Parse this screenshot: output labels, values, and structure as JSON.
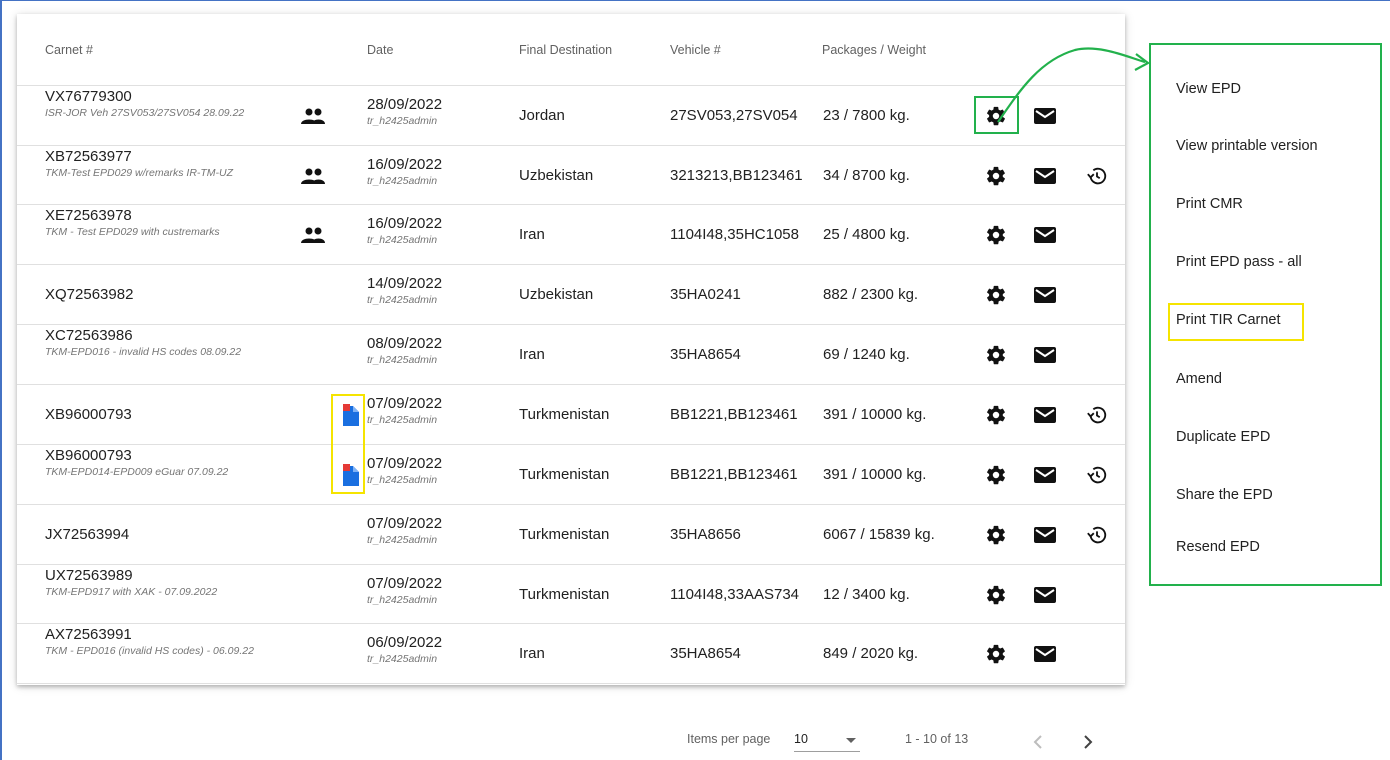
{
  "table": {
    "headers": {
      "carnet": "Carnet #",
      "date": "Date",
      "destination": "Final Destination",
      "vehicle": "Vehicle #",
      "packages": "Packages / Weight"
    },
    "rows": [
      {
        "carnet": "VX76779300",
        "remark": "ISR-JOR Veh 27SV053/27SV054 28.09.22",
        "date": "28/09/2022",
        "user": "tr_h2425admin",
        "destination": "Jordan",
        "vehicle": "27SV053,27SV054",
        "packages": "23 / 7800 kg."
      },
      {
        "carnet": "XB72563977",
        "remark": "TKM-Test EPD029 w/remarks IR-TM-UZ",
        "date": "16/09/2022",
        "user": "tr_h2425admin",
        "destination": "Uzbekistan",
        "vehicle": "3213213,BB123461",
        "packages": "34 / 8700 kg."
      },
      {
        "carnet": "XE72563978",
        "remark": "TKM - Test EPD029 with custremarks",
        "date": "16/09/2022",
        "user": "tr_h2425admin",
        "destination": "Iran",
        "vehicle": "1104I48,35HC1058",
        "packages": "25 / 4800 kg."
      },
      {
        "carnet": "XQ72563982",
        "remark": "",
        "date": "14/09/2022",
        "user": "tr_h2425admin",
        "destination": "Uzbekistan",
        "vehicle": "35HA0241",
        "packages": "882 / 2300 kg."
      },
      {
        "carnet": "XC72563986",
        "remark": "TKM-EPD016 - invalid HS codes 08.09.22",
        "date": "08/09/2022",
        "user": "tr_h2425admin",
        "destination": "Iran",
        "vehicle": "35HA8654",
        "packages": "69 / 1240 kg."
      },
      {
        "carnet": "XB96000793",
        "remark": "",
        "date": "07/09/2022",
        "user": "tr_h2425admin",
        "destination": "Turkmenistan",
        "vehicle": "BB1221,BB123461",
        "packages": "391 / 10000 kg."
      },
      {
        "carnet": "XB96000793",
        "remark": "TKM-EPD014-EPD009 eGuar 07.09.22",
        "date": "07/09/2022",
        "user": "tr_h2425admin",
        "destination": "Turkmenistan",
        "vehicle": "BB1221,BB123461",
        "packages": "391 / 10000 kg."
      },
      {
        "carnet": "JX72563994",
        "remark": "",
        "date": "07/09/2022",
        "user": "tr_h2425admin",
        "destination": "Turkmenistan",
        "vehicle": "35HA8656",
        "packages": "6067 / 15839 kg."
      },
      {
        "carnet": "UX72563989",
        "remark": "TKM-EPD917 with XAK - 07.09.2022",
        "date": "07/09/2022",
        "user": "tr_h2425admin",
        "destination": "Turkmenistan",
        "vehicle": "1104I48,33AAS734",
        "packages": "12 / 3400 kg."
      },
      {
        "carnet": "AX72563991",
        "remark": "TKM - EPD016 (invalid HS codes) - 06.09.22",
        "date": "06/09/2022",
        "user": "tr_h2425admin",
        "destination": "Iran",
        "vehicle": "35HA8654",
        "packages": "849 / 2020 kg."
      }
    ]
  },
  "menu": {
    "items": [
      "View EPD",
      "View printable version",
      "Print CMR",
      "Print EPD pass - all",
      "Print TIR Carnet",
      "Amend",
      "Duplicate EPD",
      "Share the EPD",
      "Resend EPD"
    ]
  },
  "pager": {
    "items_per_page_label": "Items per page",
    "items_per_page_value": "10",
    "range": "1 - 10 of 13"
  },
  "icons": {
    "people": "group-icon",
    "settings": "gear-icon",
    "mail": "mail-icon",
    "history": "history-icon",
    "document": "document-icon"
  },
  "colors": {
    "highlight_green": "#22b14c",
    "highlight_yellow": "#f5e400",
    "frame_blue": "#4472c4"
  }
}
